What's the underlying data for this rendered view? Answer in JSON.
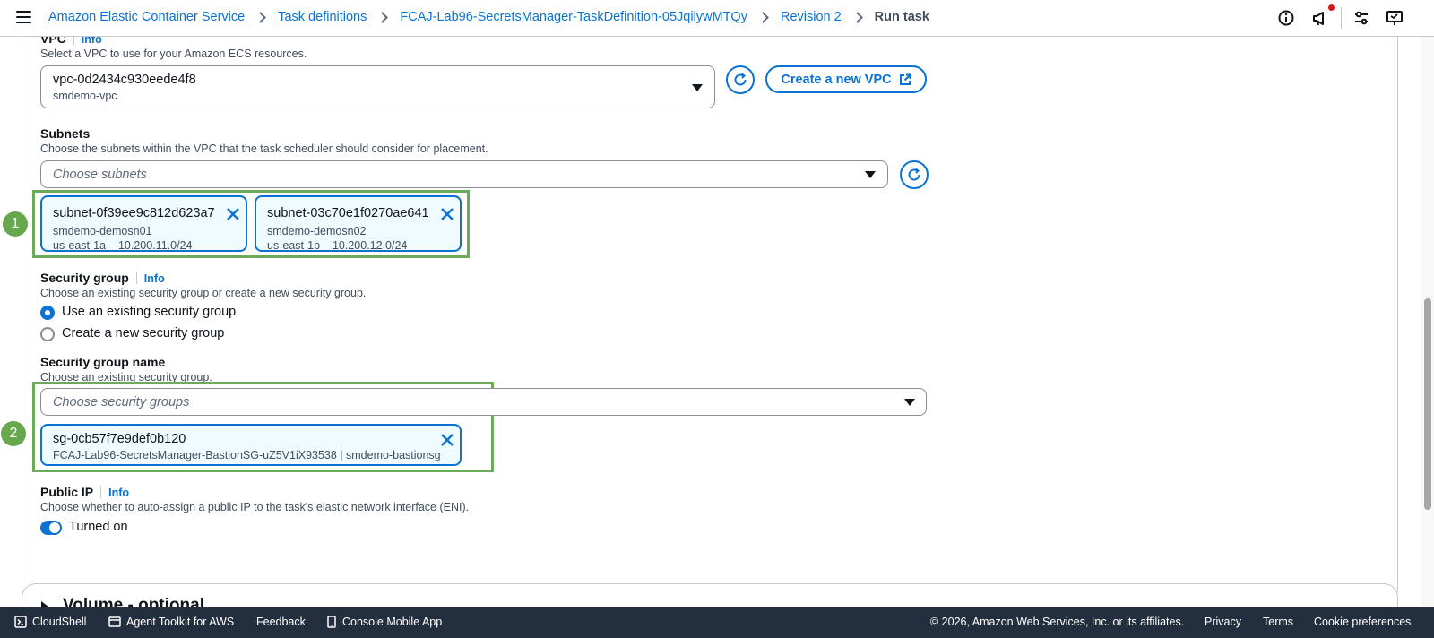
{
  "breadcrumb": {
    "items": [
      "Amazon Elastic Container Service",
      "Task definitions",
      "FCAJ-Lab96-SecretsManager-TaskDefinition-05JqilywMTQy",
      "Revision 2"
    ],
    "current": "Run task"
  },
  "topbar": {
    "icons": [
      "info-icon",
      "megaphone-icon",
      "settings-sliders-icon",
      "cloud-console-icon"
    ],
    "notification_color": "#d91515"
  },
  "vpc": {
    "label": "VPC",
    "info": "Info",
    "description": "Select a VPC to use for your Amazon ECS resources.",
    "value": "vpc-0d2434c930eede4f8",
    "value_sub": "smdemo-vpc",
    "create_label": "Create a new VPC"
  },
  "subnets": {
    "label": "Subnets",
    "description": "Choose the subnets within the VPC that the task scheduler should consider for placement.",
    "placeholder": "Choose subnets",
    "tokens": [
      {
        "id": "subnet-0f39ee9c812d623a7",
        "name": "smdemo-demosn01",
        "az": "us-east-1a",
        "cidr": "10.200.11.0/24"
      },
      {
        "id": "subnet-03c70e1f0270ae641",
        "name": "smdemo-demosn02",
        "az": "us-east-1b",
        "cidr": "10.200.12.0/24"
      }
    ]
  },
  "security_group": {
    "label": "Security group",
    "info": "Info",
    "description": "Choose an existing security group or create a new security group.",
    "options": [
      {
        "label": "Use an existing security group",
        "selected": true
      },
      {
        "label": "Create a new security group",
        "selected": false
      }
    ]
  },
  "security_group_name": {
    "label": "Security group name",
    "description": "Choose an existing security group.",
    "placeholder": "Choose security groups",
    "token": {
      "id": "sg-0cb57f7e9def0b120",
      "detail": "FCAJ-Lab96-SecretsManager-BastionSG-uZ5V1iX93538 | smdemo-bastionsg"
    }
  },
  "public_ip": {
    "label": "Public IP",
    "info": "Info",
    "description": "Choose whether to auto-assign a public IP to the task's elastic network interface (ENI).",
    "toggle_label": "Turned on",
    "enabled": true
  },
  "next_section": {
    "title": "Volume - optional"
  },
  "annotations": {
    "step1": "1",
    "step2": "2",
    "highlight_color": "#6aaa5a"
  },
  "footer": {
    "cloudshell": "CloudShell",
    "agent_toolkit": "Agent Toolkit for AWS",
    "feedback": "Feedback",
    "mobile_app": "Console Mobile App",
    "copyright": "© 2026, Amazon Web Services, Inc. or its affiliates.",
    "privacy": "Privacy",
    "terms": "Terms",
    "cookies": "Cookie preferences"
  },
  "colors": {
    "accent": "#0972d3",
    "footer_bg": "#232f3e",
    "step_badge": "#67a84f"
  }
}
